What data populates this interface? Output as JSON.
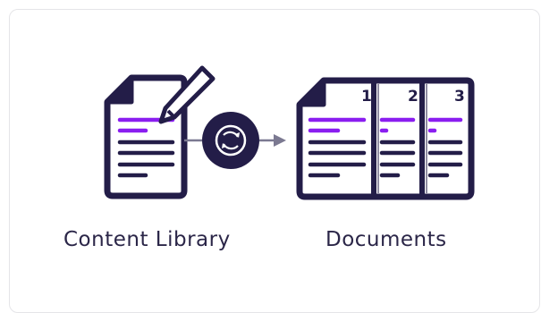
{
  "diagram": {
    "source_label": "Content Library",
    "target_label": "Documents",
    "pages": [
      "1",
      "2",
      "3"
    ],
    "sync_icon": "refresh-icon",
    "edit_icon": "pencil-icon"
  },
  "colors": {
    "navy": "#231d48",
    "purple": "#8a1ef0",
    "arrow": "#7b7991",
    "border": "#e5e5e8"
  }
}
